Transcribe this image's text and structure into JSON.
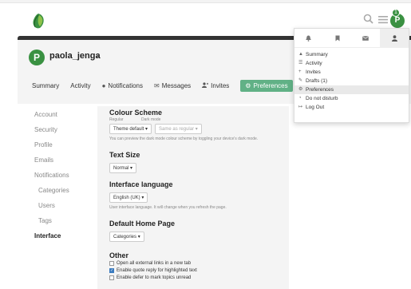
{
  "header": {
    "search_icon": "search-icon",
    "menu_icon": "hamburger-icon",
    "avatar_letter": "P",
    "notification_count": "1"
  },
  "profile": {
    "avatar_letter": "P",
    "username": "paola_jenga",
    "flag_icon": "◐"
  },
  "tabs": [
    {
      "label": "Summary",
      "icon": ""
    },
    {
      "label": "Activity",
      "icon": ""
    },
    {
      "label": "Notifications",
      "icon": "●"
    },
    {
      "label": "Messages",
      "icon": "✉"
    },
    {
      "label": "Invites",
      "icon": "👤"
    },
    {
      "label": "Preferences",
      "icon": "⚙"
    }
  ],
  "sidenav": {
    "items": [
      "Account",
      "Security",
      "Profile",
      "Emails",
      "Notifications",
      "Categories",
      "Users",
      "Tags",
      "Interface"
    ]
  },
  "prefs": {
    "colour_scheme": {
      "title": "Colour Scheme",
      "regular_label": "Regular",
      "dark_label": "Dark mode",
      "regular_value": "Theme default",
      "dark_value": "Same as regular",
      "hint": "You can preview the dark mode colour scheme by toggling your device's dark mode."
    },
    "text_size": {
      "title": "Text Size",
      "value": "Normal"
    },
    "interface_language": {
      "title": "Interface language",
      "value": "English (UK)",
      "hint": "User interface language. It will change when you refresh the page."
    },
    "default_home": {
      "title": "Default Home Page",
      "value": "Categories"
    },
    "other": {
      "title": "Other",
      "options": [
        {
          "label": "Open all external links in a new tab",
          "checked": false
        },
        {
          "label": "Enable quote reply for highlighted text",
          "checked": true
        },
        {
          "label": "Enable defer to mark topics unread",
          "checked": false
        }
      ]
    }
  },
  "user_menu": {
    "tabs": [
      "bell-icon",
      "bookmark-icon",
      "envelope-icon",
      "user-icon"
    ],
    "items": [
      {
        "label": "Summary",
        "icon": "▲"
      },
      {
        "label": "Activity",
        "icon": "☰"
      },
      {
        "label": "Invites",
        "icon": "+"
      },
      {
        "label": "Drafts (1)",
        "icon": "✎"
      },
      {
        "label": "Preferences",
        "icon": "⚙"
      },
      {
        "label": "Do not disturb",
        "icon": "◔"
      },
      {
        "label": "Log Out",
        "icon": "↦"
      }
    ],
    "highlighted": "Preferences"
  },
  "colors": {
    "brand_green": "#3a9142",
    "tab_active": "#61b186",
    "checkbox_blue": "#3b7bbf"
  }
}
